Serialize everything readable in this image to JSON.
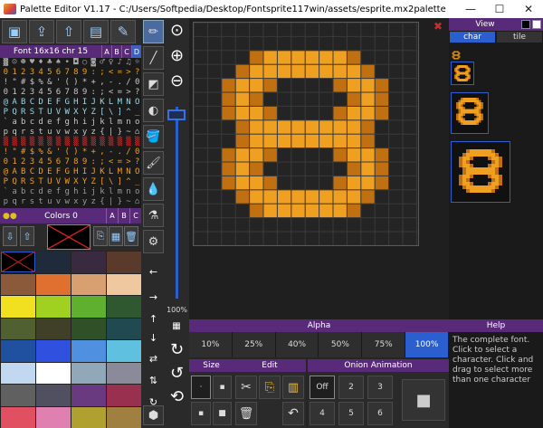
{
  "window": {
    "title": "Palette Editor V1.17 - C:/Users/Softpedia/Desktop/Fontsprite117win/assets/esprite.mx2palette",
    "minimize": "—",
    "maximize": "☐",
    "close": "✕"
  },
  "toolbar": {
    "buttons": [
      "new-file-icon",
      "open-file-icon",
      "open-folder-icon",
      "save-icon",
      "save-as-icon"
    ]
  },
  "font_panel": {
    "title": "Font 16x16   chr 15",
    "tabs": [
      "A",
      "B",
      "C",
      "D"
    ],
    "selected_tab": "D",
    "rows": [
      {
        "text": "▓☺☻♥♦♣♠•◘○◙♂♀♪♫☼",
        "color": "#a8a8a8"
      },
      {
        "text": "0123456789:;<=>?",
        "color": "#f0a020"
      },
      {
        "text": "!\"#$%&'()*+,-./0",
        "color": "#c8c8c8"
      },
      {
        "text": "0123456789:;<=>?",
        "color": "#c8c8c8"
      },
      {
        "text": "@ABCDEFGHIJKLMNO",
        "color": "#9ad8e8"
      },
      {
        "text": "PQRSTUVWXYZ[\\]^_",
        "color": "#9ad8e8"
      },
      {
        "text": "`abcdefghijklmno",
        "color": "#c8c8c8"
      },
      {
        "text": "pqrstuvwxyz{|}~⌂",
        "color": "#c8c8c8"
      },
      {
        "text": "▒▒▒▒▒▒▒▒▒▒▒▒▒▒▒▒",
        "color": "#d03030"
      },
      {
        "text": "!\"#$%&'()*+,-./0",
        "color": "#f0a020"
      },
      {
        "text": "0123456789:;<=>?",
        "color": "#f0a020"
      },
      {
        "text": "@ABCDEFGHIJKLMNO",
        "color": "#f0a020"
      },
      {
        "text": "PQRSTUVWXYZ[\\]^_",
        "color": "#f0a020"
      },
      {
        "text": "`abcdefghijklmno",
        "color": "#9a9a9a"
      },
      {
        "text": "pqrstuvwxyz{|}~⌂",
        "color": "#9a9a9a"
      }
    ]
  },
  "colors_panel": {
    "title": "Colors 0",
    "tabs": [
      "A",
      "B",
      "C"
    ],
    "tools": [
      "import-palette-icon",
      "export-palette-icon",
      "copy-color-icon",
      "paste-color-icon",
      "delete-color-icon"
    ],
    "swatches": [
      "#000000",
      "#1f2a3a",
      "#3a2a40",
      "#5a3a2a",
      "#8a5a3a",
      "#e07030",
      "#d8a070",
      "#f0c8a0",
      "#f0e020",
      "#a0d020",
      "#60b030",
      "#305830",
      "#506030",
      "#404028",
      "#305028",
      "#204a50",
      "#2050a0",
      "#3050e0",
      "#5090e0",
      "#60c0e0",
      "#c0d8f0",
      "#ffffff",
      "#90a8b8",
      "#8a8a9a",
      "#606060",
      "#505060",
      "#6a3a80",
      "#9a3050",
      "#e05060",
      "#e080b0",
      "#b0a030",
      "#a08040"
    ]
  },
  "tools": {
    "items": [
      "pencil-icon",
      "line-icon",
      "fill-rect-icon",
      "eraser-icon",
      "bucket-icon",
      "brush-icon",
      "eyedropper-icon",
      "color-picker-icon",
      "replace-color-icon"
    ],
    "selected": "pencil-icon",
    "arrows": [
      "←",
      "→",
      "↑",
      "↓",
      "⇄",
      "⇅",
      "↻",
      "↺",
      "⤾"
    ]
  },
  "zoom": {
    "in_label": "+",
    "out_label": "−",
    "level_label": "100%",
    "level_fraction": 0.05
  },
  "canvas": {
    "grid_size": 16,
    "glyph_color": "#f0a020",
    "glyph_shadow": "#c07010"
  },
  "view_panel": {
    "title": "View",
    "tabs": [
      "char",
      "tile"
    ],
    "selected_tab": "char"
  },
  "alpha_panel": {
    "title": "Alpha",
    "options": [
      "10%",
      "25%",
      "40%",
      "50%",
      "75%",
      "100%"
    ],
    "selected": "100%"
  },
  "help_panel": {
    "title": "Help",
    "text": "The complete font. Click to select a character. Click and drag to select more than one character"
  },
  "size_panel": {
    "title": "Size",
    "buttons": [
      "1x1",
      "2x1",
      "1x2",
      "2x2"
    ]
  },
  "edit_panel": {
    "title": "Edit",
    "buttons": [
      "cut-icon",
      "copy-icon",
      "paste-icon",
      "undo-icon",
      "delete-icon"
    ]
  },
  "onion_panel": {
    "title": "Onion Animation",
    "buttons": [
      "Off",
      "2",
      "3",
      "4",
      "5",
      "6"
    ],
    "selected": "Off",
    "stop_label": "■"
  }
}
